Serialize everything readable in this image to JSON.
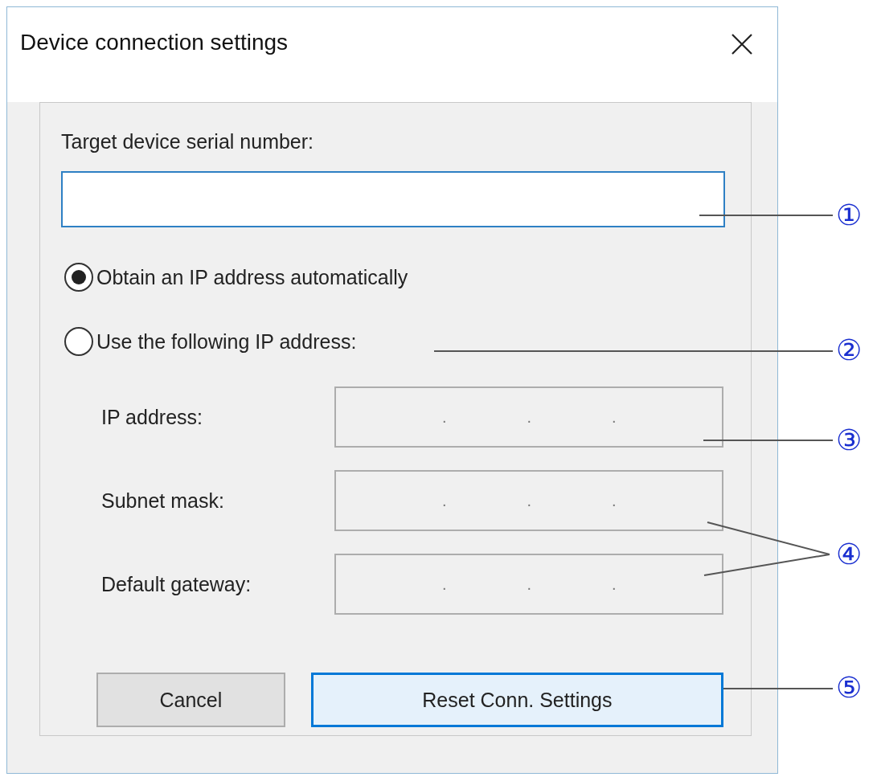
{
  "window": {
    "title": "Device connection settings"
  },
  "serial_field": {
    "label": "Target device serial number:"
  },
  "ip_mode": [
    {
      "label": "Obtain an IP address automatically",
      "selected": true
    },
    {
      "label": "Use the following IP address:",
      "selected": false
    }
  ],
  "address_fields": [
    {
      "label": "IP address:",
      "disabled": true,
      "dots": [
        ".",
        ".",
        "."
      ]
    },
    {
      "label": "Subnet mask:",
      "disabled": true,
      "dots": [
        ".",
        ".",
        "."
      ]
    },
    {
      "label": "Default gateway:",
      "disabled": true,
      "dots": [
        ".",
        ".",
        "."
      ]
    }
  ],
  "buttons": [
    {
      "label": "Cancel",
      "default": false
    },
    {
      "label": "Reset Conn. Settings",
      "default": true
    }
  ],
  "callouts": [
    {
      "label": "①"
    },
    {
      "label": "②"
    },
    {
      "label": "③"
    },
    {
      "label": "④"
    },
    {
      "label": "⑤"
    }
  ]
}
